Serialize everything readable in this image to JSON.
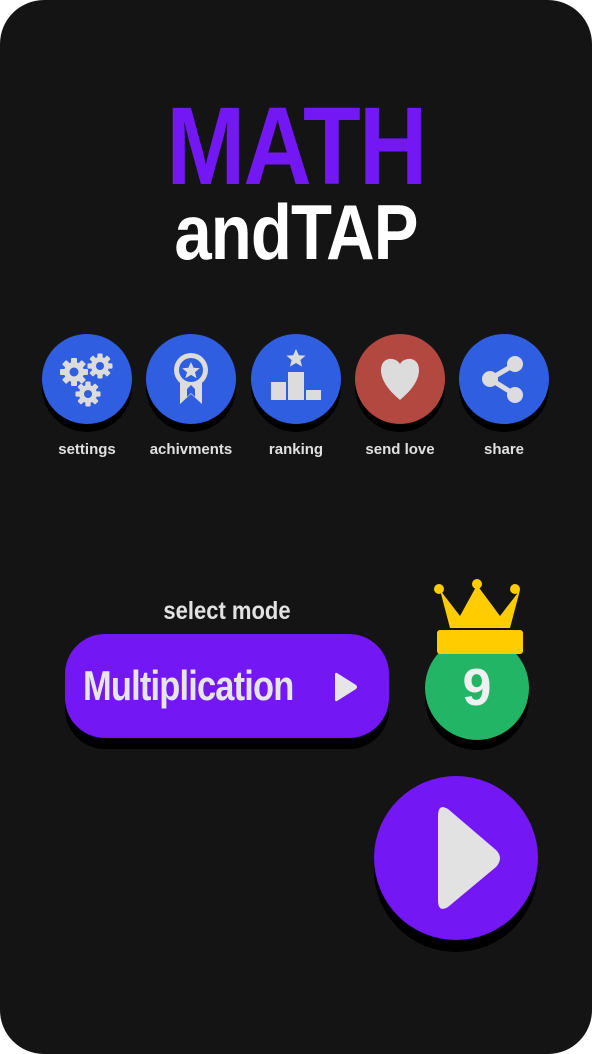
{
  "title": {
    "line1": "MATH",
    "line2": "andTAP"
  },
  "menu": [
    {
      "label": "settings",
      "icon": "settings-gears-icon",
      "color": "#2f5fe0"
    },
    {
      "label": "achivments",
      "icon": "achievement-badge-icon",
      "color": "#2f5fe0"
    },
    {
      "label": "ranking",
      "icon": "ranking-podium-icon",
      "color": "#2f5fe0"
    },
    {
      "label": "send love",
      "icon": "heart-icon",
      "color": "#b2483f"
    },
    {
      "label": "share",
      "icon": "share-icon",
      "color": "#2f5fe0"
    }
  ],
  "mode": {
    "label": "select mode",
    "value": "Multiplication",
    "arrow_icon": "play-triangle-icon"
  },
  "best": {
    "score": "9",
    "crown_icon": "crown-icon",
    "color": "#22b565"
  },
  "play": {
    "icon": "play-icon"
  },
  "colors": {
    "background": "#141414",
    "accent_purple": "#7317f5",
    "blue": "#2f5fe0",
    "red": "#b2483f",
    "green": "#22b565",
    "crown": "#ffcc00"
  }
}
